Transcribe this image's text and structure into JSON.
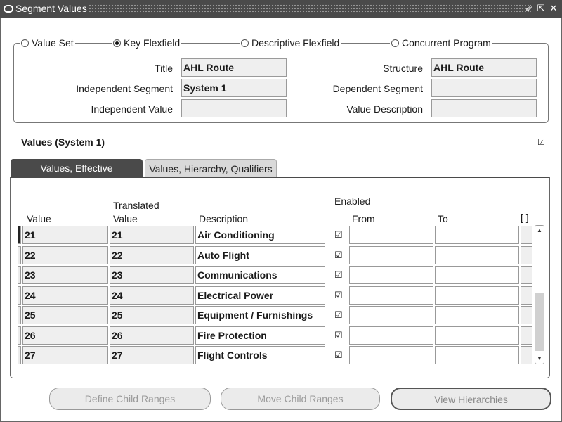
{
  "window": {
    "title": "Segment Values",
    "controls": [
      "⇙",
      "⇱",
      "✕"
    ]
  },
  "segment": {
    "radios": [
      {
        "label": "Value Set",
        "selected": false
      },
      {
        "label": "Key Flexfield",
        "selected": true
      },
      {
        "label": "Descriptive Flexfield",
        "selected": false
      },
      {
        "label": "Concurrent Program",
        "selected": false
      }
    ],
    "title_label": "Title",
    "title_value": "AHL Route",
    "structure_label": "Structure",
    "structure_value": "AHL Route",
    "independent_segment_label": "Independent Segment",
    "independent_segment_value": "System 1",
    "dependent_segment_label": "Dependent Segment",
    "dependent_segment_value": "",
    "independent_value_label": "Independent Value",
    "independent_value_value": "",
    "value_description_label": "Value Description",
    "value_description_value": ""
  },
  "values_section": {
    "title": "Values (System 1)",
    "checked": true,
    "tabs": [
      {
        "label": "Values, Effective",
        "active": true
      },
      {
        "label": "Values, Hierarchy, Qualifiers",
        "active": false
      }
    ],
    "headers": {
      "value": "Value",
      "translated_1": "Translated",
      "translated_2": "Value",
      "description": "Description",
      "enabled": "Enabled",
      "from": "From",
      "to": "To",
      "flex": "[ ]"
    },
    "rows": [
      {
        "value": "21",
        "translated": "21",
        "description": "Air Conditioning",
        "enabled": true,
        "from": "",
        "to": ""
      },
      {
        "value": "22",
        "translated": "22",
        "description": "Auto Flight",
        "enabled": true,
        "from": "",
        "to": ""
      },
      {
        "value": "23",
        "translated": "23",
        "description": "Communications",
        "enabled": true,
        "from": "",
        "to": ""
      },
      {
        "value": "24",
        "translated": "24",
        "description": "Electrical Power",
        "enabled": true,
        "from": "",
        "to": ""
      },
      {
        "value": "25",
        "translated": "25",
        "description": "Equipment / Furnishings",
        "enabled": true,
        "from": "",
        "to": ""
      },
      {
        "value": "26",
        "translated": "26",
        "description": "Fire Protection",
        "enabled": true,
        "from": "",
        "to": ""
      },
      {
        "value": "27",
        "translated": "27",
        "description": "Flight Controls",
        "enabled": true,
        "from": "",
        "to": ""
      }
    ]
  },
  "buttons": {
    "define_child_ranges": "Define Child Ranges",
    "move_child_ranges": "Move Child Ranges",
    "view_hierarchies": "View Hierarchies"
  },
  "icons": {
    "window": "window-icon",
    "checkbox": "checkmark-icon",
    "scroll_up": "scroll-up-arrow-icon",
    "scroll_down": "scroll-down-arrow-icon"
  }
}
